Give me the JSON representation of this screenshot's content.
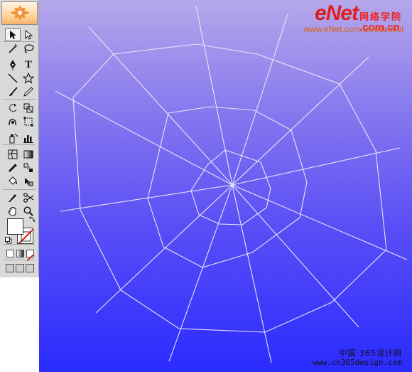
{
  "toolbox": {
    "tools": [
      {
        "name": "selection-tool-icon",
        "glyph": "arrow",
        "selected": true
      },
      {
        "name": "direct-selection-tool-icon",
        "glyph": "arrow-hollow",
        "selected": false
      },
      {
        "name": "magic-wand-tool-icon",
        "glyph": "wand"
      },
      {
        "name": "lasso-tool-icon",
        "glyph": "lasso"
      },
      {
        "name": "pen-tool-icon",
        "glyph": "pen"
      },
      {
        "name": "type-tool-icon",
        "glyph": "T"
      },
      {
        "name": "line-segment-tool-icon",
        "glyph": "line"
      },
      {
        "name": "star-tool-icon",
        "glyph": "star"
      },
      {
        "name": "paintbrush-tool-icon",
        "glyph": "brush"
      },
      {
        "name": "pencil-tool-icon",
        "glyph": "pencil"
      },
      {
        "name": "rotate-tool-icon",
        "glyph": "rotate"
      },
      {
        "name": "scale-tool-icon",
        "glyph": "scale"
      },
      {
        "name": "warp-tool-icon",
        "glyph": "warp"
      },
      {
        "name": "free-transform-tool-icon",
        "glyph": "transform"
      },
      {
        "name": "symbol-sprayer-tool-icon",
        "glyph": "sprayer"
      },
      {
        "name": "column-graph-tool-icon",
        "glyph": "graph"
      },
      {
        "name": "mesh-tool-icon",
        "glyph": "mesh"
      },
      {
        "name": "gradient-tool-icon",
        "glyph": "gradient"
      },
      {
        "name": "eyedropper-tool-icon",
        "glyph": "eyedropper"
      },
      {
        "name": "blend-tool-icon",
        "glyph": "blend"
      },
      {
        "name": "live-paint-bucket-tool-icon",
        "glyph": "bucket"
      },
      {
        "name": "live-paint-selection-tool-icon",
        "glyph": "paint-select"
      },
      {
        "name": "slice-tool-icon",
        "glyph": "knife"
      },
      {
        "name": "scissors-tool-icon",
        "glyph": "scissors"
      },
      {
        "name": "hand-tool-icon",
        "glyph": "hand"
      },
      {
        "name": "zoom-tool-icon",
        "glyph": "zoom"
      }
    ],
    "type_glyph": "T",
    "fill_color": "#ffffff",
    "stroke_color": "none"
  },
  "watermark": {
    "logo_e": "e",
    "logo_net": "Net",
    "logo_cn_top": "网络学院",
    "logo_cn_bottom": ".com.cn",
    "url": "www.eNet.com.cn/eschool",
    "bottom_line1": "中国·365设计网",
    "bottom_line2": "www.cn365design.com"
  },
  "colors": {
    "canvas_top": "#b5a8ea",
    "canvas_bottom": "#2a2bff",
    "web_stroke": "#e8e6f6",
    "accent": "#d61b1b"
  }
}
